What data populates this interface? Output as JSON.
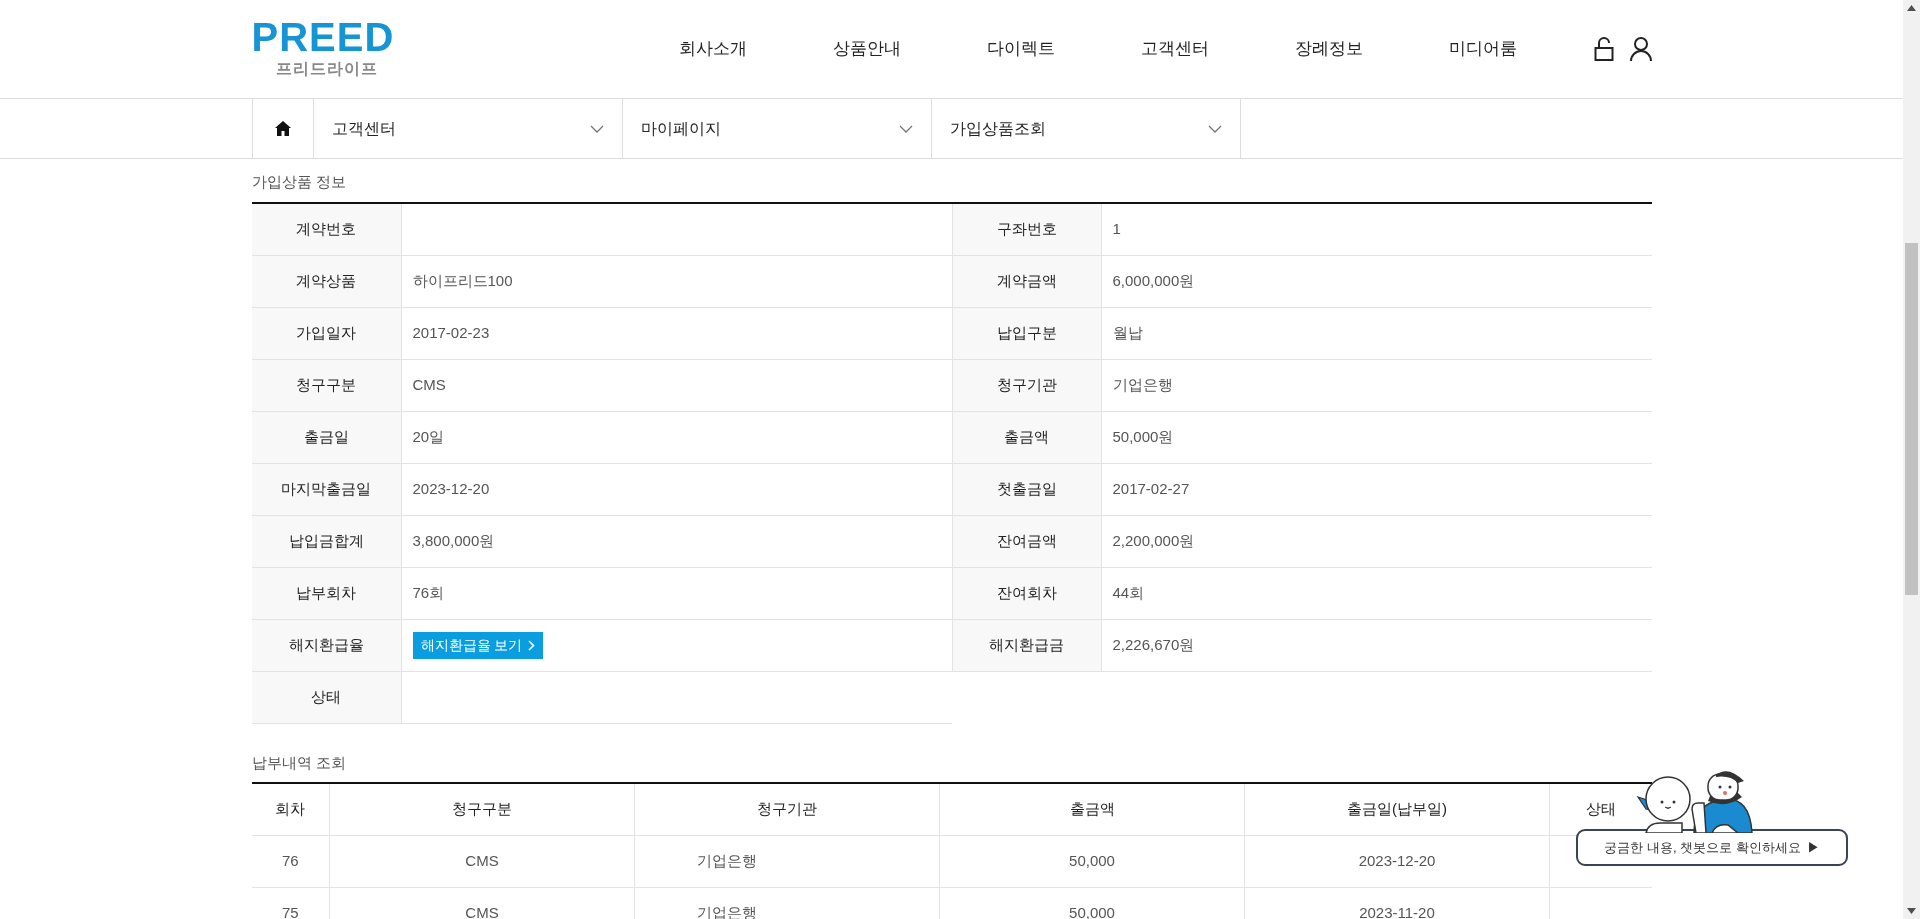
{
  "header": {
    "logo": {
      "brand": "PREED",
      "subtitle": "프리드라이프"
    },
    "nav": [
      "회사소개",
      "상품안내",
      "다이렉트",
      "고객센터",
      "장례정보",
      "미디어룸"
    ]
  },
  "breadcrumb": [
    "고객센터",
    "마이페이지",
    "가입상품조회"
  ],
  "product_info": {
    "title": "가입상품 정보",
    "rows": [
      {
        "cells": [
          {
            "label": "계약번호"
          },
          {
            "label": "구좌번호",
            "value": "1"
          }
        ]
      },
      {
        "cells": [
          {
            "label": "계약상품",
            "value": "하이프리드100"
          },
          {
            "label": "계약금액",
            "value": "6,000,000원"
          }
        ]
      },
      {
        "cells": [
          {
            "label": "가입일자",
            "value": "2017-02-23"
          },
          {
            "label": "납입구분",
            "value": "월납"
          }
        ]
      },
      {
        "cells": [
          {
            "label": "청구구분",
            "value": "CMS"
          },
          {
            "label": "청구기관",
            "value": "기업은행"
          }
        ]
      },
      {
        "cells": [
          {
            "label": "출금일",
            "value": "20일"
          },
          {
            "label": "출금액",
            "value": "50,000원"
          }
        ]
      },
      {
        "cells": [
          {
            "label": "마지막출금일",
            "value": "2023-12-20"
          },
          {
            "label": "첫출금일",
            "value": "2017-02-27"
          }
        ]
      },
      {
        "cells": [
          {
            "label": "납입금합계",
            "value": "3,800,000원"
          },
          {
            "label": "잔여금액",
            "value": "2,200,000원"
          }
        ]
      },
      {
        "cells": [
          {
            "label": "납부회차",
            "value": "76회"
          },
          {
            "label": "잔여회차",
            "value": "44회"
          }
        ]
      },
      {
        "cells": [
          {
            "label": "해지환급율",
            "kind": "button",
            "value": "해지환급율 보기"
          },
          {
            "label": "해지환급금",
            "value": "2,226,670원"
          }
        ]
      },
      {
        "cells": [
          {
            "label": "상태"
          }
        ]
      }
    ]
  },
  "payment_history": {
    "title": "납부내역 조회",
    "columns": [
      "회차",
      "청구구분",
      "청구기관",
      "출금액",
      "출금일(납부일)",
      "상태"
    ],
    "rows": [
      [
        "76",
        "CMS",
        "기업은행",
        "50,000",
        "2023-12-20",
        ""
      ],
      [
        "75",
        "CMS",
        "기업은행",
        "50,000",
        "2023-11-20",
        ""
      ]
    ]
  },
  "chatbot": {
    "text": "궁금한 내용, 챗봇으로 확인하세요",
    "arrow": "▶"
  }
}
